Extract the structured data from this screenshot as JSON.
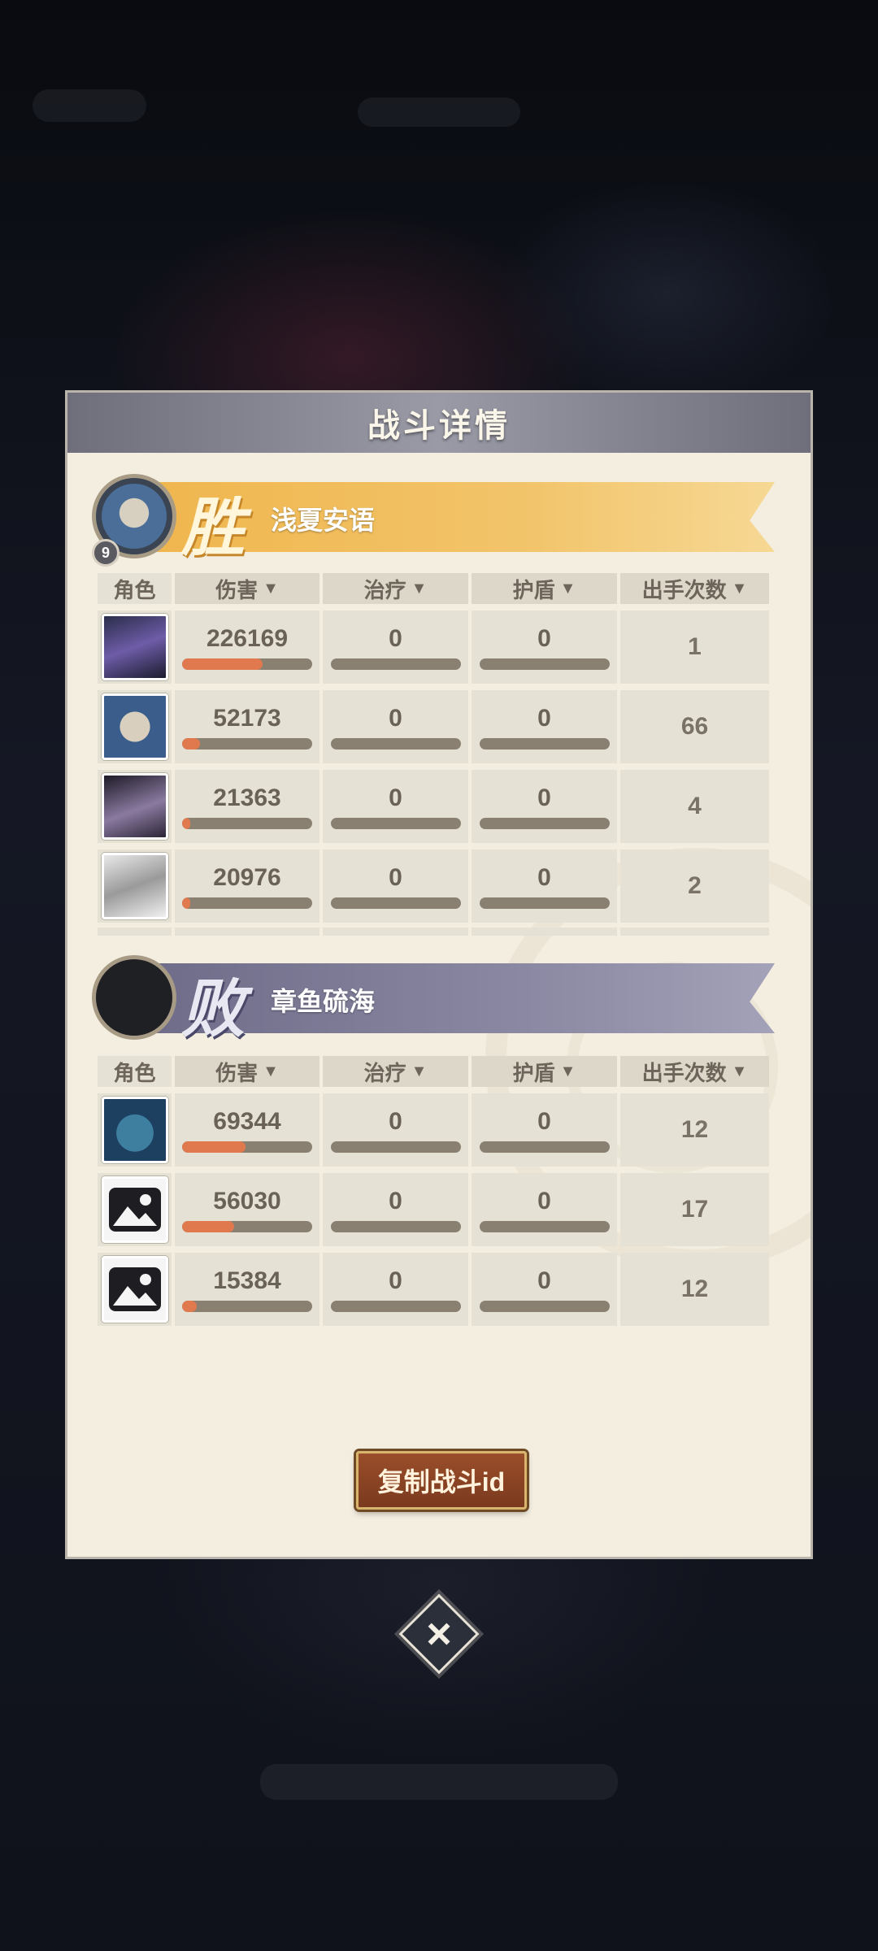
{
  "dialog": {
    "title": "战斗详情",
    "copy_button": "复制战斗id"
  },
  "columns": [
    "角色",
    "伤害",
    "治疗",
    "护盾",
    "出手次数"
  ],
  "winner": {
    "result": "胜",
    "name": "浅夏安语",
    "level": "9",
    "rows": [
      {
        "damage": "226169",
        "damage_ratio": 0.62,
        "heal": "0",
        "shield": "0",
        "actions": "1"
      },
      {
        "damage": "52173",
        "damage_ratio": 0.14,
        "heal": "0",
        "shield": "0",
        "actions": "66"
      },
      {
        "damage": "21363",
        "damage_ratio": 0.06,
        "heal": "0",
        "shield": "0",
        "actions": "4"
      },
      {
        "damage": "20976",
        "damage_ratio": 0.06,
        "heal": "0",
        "shield": "0",
        "actions": "2"
      }
    ]
  },
  "loser": {
    "result": "败",
    "name": "章鱼硫海",
    "rows": [
      {
        "damage": "69344",
        "damage_ratio": 0.49,
        "heal": "0",
        "shield": "0",
        "actions": "12"
      },
      {
        "damage": "56030",
        "damage_ratio": 0.4,
        "heal": "0",
        "shield": "0",
        "actions": "17"
      },
      {
        "damage": "15384",
        "damage_ratio": 0.11,
        "heal": "0",
        "shield": "0",
        "actions": "12"
      }
    ]
  },
  "colors": {
    "win_banner": "#f0b64e",
    "lose_banner": "#8a88a2",
    "damage_bar": "#e07a4e",
    "copy_button": "#9a4e2a"
  }
}
